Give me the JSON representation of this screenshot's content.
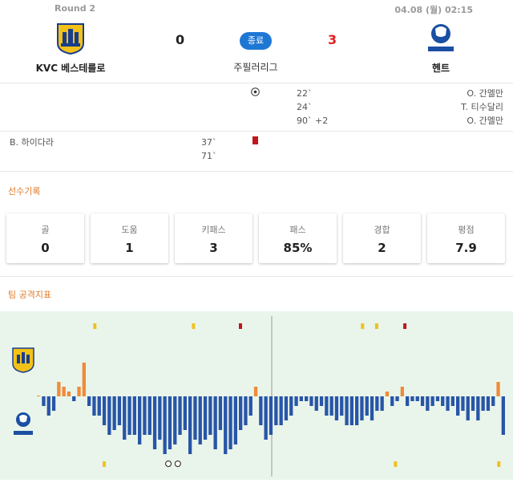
{
  "header": {
    "round": "Round 2",
    "datetime": "04.08 (월) 02:15"
  },
  "match": {
    "home": {
      "name": "KVC 베스테를로",
      "score": "0",
      "crest": "westerlo-crest-icon"
    },
    "away": {
      "name": "헨트",
      "score": "3",
      "crest": "gent-crest-icon"
    },
    "status": "종료",
    "league": "주필러리그"
  },
  "events": {
    "away_goal_minutes": [
      "22`",
      "24`",
      "90` +2"
    ],
    "away_scorers": [
      "O. 간멜만",
      "T. 티수달리",
      "O. 간멜만"
    ],
    "home_player": "B. 하이다라",
    "home_minutes": [
      "37`",
      "71`"
    ]
  },
  "player_stats": {
    "title": "선수기록",
    "cards": [
      {
        "label": "골",
        "value": "0"
      },
      {
        "label": "도움",
        "value": "1"
      },
      {
        "label": "키패스",
        "value": "3"
      },
      {
        "label": "패스",
        "value": "85%"
      },
      {
        "label": "경합",
        "value": "2"
      },
      {
        "label": "평점",
        "value": "7.9"
      }
    ]
  },
  "attack_index": {
    "title": "팀 공격지표",
    "colors": {
      "home": "#f08a3a",
      "away": "#2855a8",
      "yellow": "#f0c020",
      "red": "#c0161b"
    },
    "chart_data": {
      "type": "bar",
      "series": [
        {
          "values": [
            0,
            -2,
            -4,
            -3,
            3,
            2,
            1,
            -1,
            2,
            7,
            -2,
            -4,
            -4,
            -6,
            -8,
            -7,
            -6,
            -9,
            -8,
            -8,
            -10,
            -8,
            -8,
            -11,
            -9,
            -12,
            -11,
            -10,
            -8,
            -7,
            -12,
            -9,
            -10,
            -9,
            -8,
            -11,
            -7,
            -12,
            -11,
            -10,
            -7,
            -6,
            -4,
            2,
            -6,
            -9,
            -8,
            -6,
            -6,
            -5,
            -4,
            -2,
            -1,
            -1,
            -2,
            -3,
            -2,
            -4,
            -4,
            -5,
            -4,
            -6,
            -6,
            -6,
            -5,
            -4,
            -5,
            -3,
            -3,
            1,
            -2,
            -1,
            2,
            -2,
            -1,
            -1,
            -2,
            -3,
            -2,
            -1,
            -2,
            -3,
            -2,
            -4,
            -3,
            -5,
            -3,
            -5,
            -3,
            -3,
            -2,
            3,
            -8
          ]
        }
      ]
    },
    "cards_top": [
      {
        "pos": 0.12,
        "type": "yellow"
      },
      {
        "pos": 0.33,
        "type": "yellow"
      },
      {
        "pos": 0.43,
        "type": "red"
      },
      {
        "pos": 0.69,
        "type": "yellow"
      },
      {
        "pos": 0.72,
        "type": "yellow"
      },
      {
        "pos": 0.78,
        "type": "red"
      }
    ],
    "cards_bottom": [
      {
        "pos": 0.14,
        "type": "yellow"
      },
      {
        "pos": 0.76,
        "type": "yellow"
      },
      {
        "pos": 0.98,
        "type": "yellow"
      }
    ],
    "goals_bottom": [
      0.28,
      0.3
    ]
  }
}
